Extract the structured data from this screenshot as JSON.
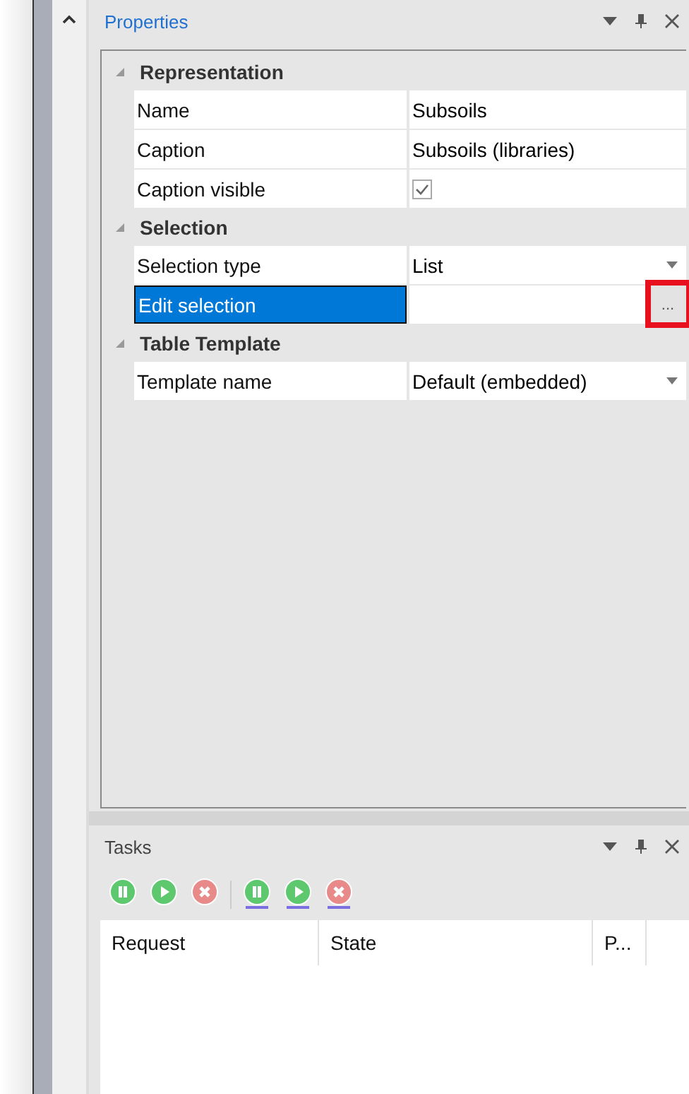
{
  "properties_panel": {
    "title": "Properties",
    "categories": [
      {
        "title": "Representation",
        "expanded": true,
        "rows": [
          {
            "name": "Name",
            "value": "Subsoils",
            "kind": "text",
            "selected": false
          },
          {
            "name": "Caption",
            "value": "Subsoils (libraries)",
            "kind": "text",
            "selected": false
          },
          {
            "name": "Caption visible",
            "kind": "checkbox",
            "checked": true,
            "selected": false
          }
        ]
      },
      {
        "title": "Selection",
        "expanded": true,
        "rows": [
          {
            "name": "Selection type",
            "value": "List",
            "kind": "dropdown",
            "selected": false
          },
          {
            "name": "Edit selection",
            "kind": "button",
            "button": "...",
            "highlighted": true,
            "selected": true
          }
        ]
      },
      {
        "title": "Table Template",
        "expanded": true,
        "rows": [
          {
            "name": "Template name",
            "value": "Default (embedded)",
            "kind": "dropdown",
            "selected": false
          }
        ]
      }
    ]
  },
  "tasks_panel": {
    "title": "Tasks",
    "toolbar": [
      {
        "kind": "pause",
        "color": "#5ec86e",
        "underlined": false
      },
      {
        "kind": "play",
        "color": "#5ec86e",
        "underlined": false
      },
      {
        "kind": "stop",
        "color": "#e88a8a",
        "underlined": false
      },
      {
        "kind": "pause",
        "color": "#5ec86e",
        "underlined": true
      },
      {
        "kind": "play",
        "color": "#5ec86e",
        "underlined": true
      },
      {
        "kind": "stop",
        "color": "#e88a8a",
        "underlined": true
      }
    ],
    "columns": [
      "Request",
      "State",
      "P..."
    ]
  }
}
